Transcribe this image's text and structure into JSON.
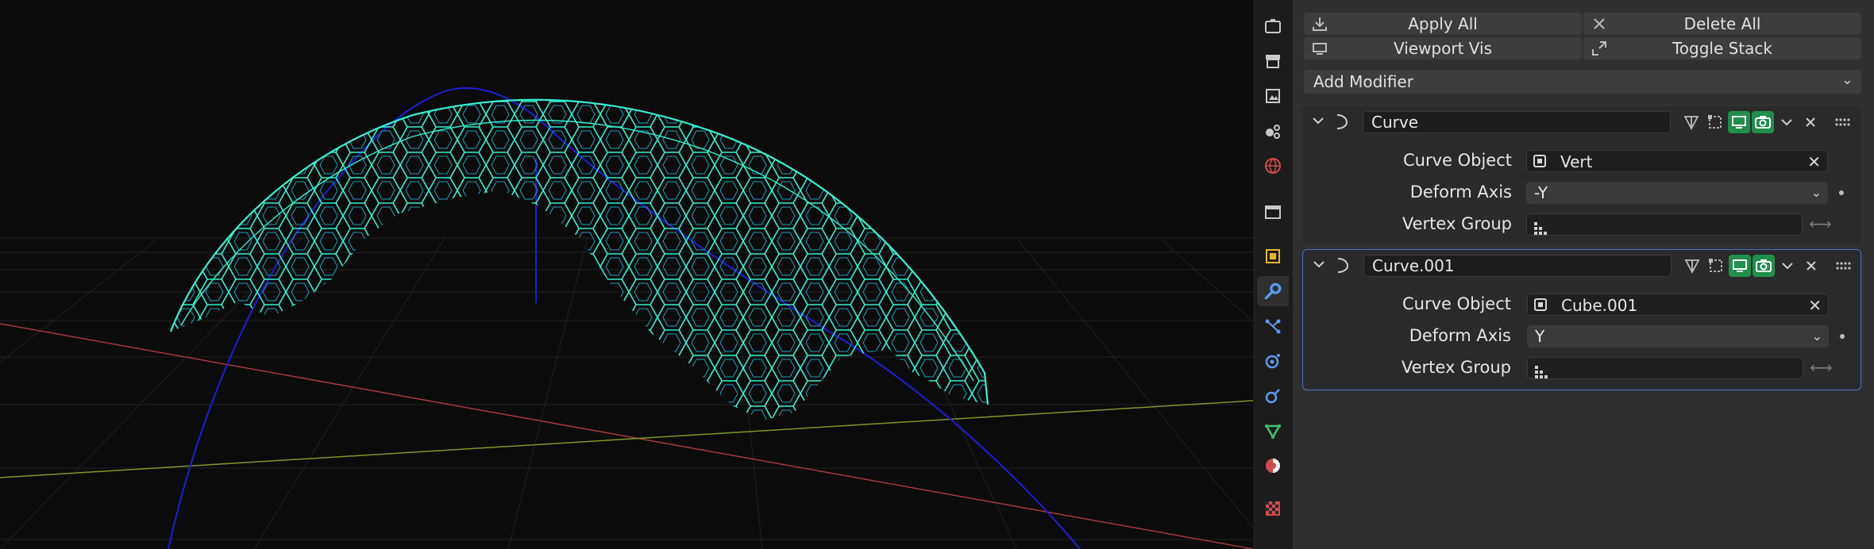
{
  "toolbar": {
    "apply_all": "Apply All",
    "delete_all": "Delete All",
    "viewport_vis": "Viewport Vis",
    "toggle_stack": "Toggle Stack",
    "add_modifier": "Add Modifier"
  },
  "labels": {
    "curve_object": "Curve Object",
    "deform_axis": "Deform Axis",
    "vertex_group": "Vertex Group"
  },
  "modifiers": [
    {
      "name": "Curve",
      "curve_object": "Vert",
      "deform_axis": "-Y",
      "vertex_group": ""
    },
    {
      "name": "Curve.001",
      "curve_object": "Cube.001",
      "deform_axis": "Y",
      "vertex_group": ""
    }
  ],
  "tabs": [
    "tool-icon",
    "render-icon",
    "output-icon",
    "view-layer-icon",
    "scene-icon",
    "world-icon",
    "collection-icon",
    "object-icon",
    "modifiers-icon",
    "particles-icon",
    "physics-icon",
    "constraints-icon",
    "data-icon",
    "material-icon",
    "texture-icon"
  ],
  "colors": {
    "wire": "#35f0d0",
    "curve": "#1d1dd6",
    "x_axis": "#a33a3a",
    "y_axis": "#7a9a2a",
    "active_panel": "#4873c7",
    "toggle_on": "#1f8f4a"
  }
}
